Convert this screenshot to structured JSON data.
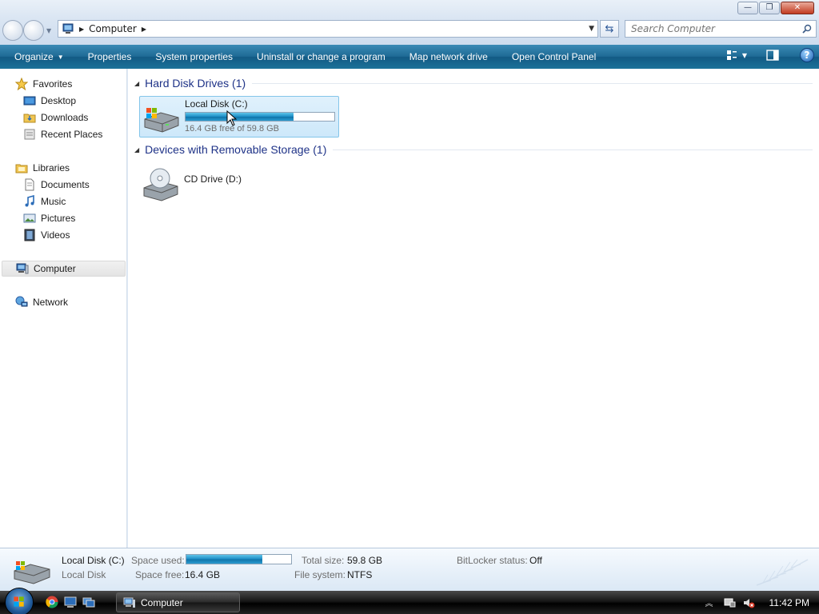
{
  "window": {
    "caption_buttons": {
      "minimize": "—",
      "maximize": "❐",
      "close": "✕"
    }
  },
  "address": {
    "crumb": "Computer",
    "search_placeholder": "Search Computer"
  },
  "toolbar": {
    "organize": "Organize",
    "properties": "Properties",
    "system_properties": "System properties",
    "uninstall": "Uninstall or change a program",
    "map_drive": "Map network drive",
    "control_panel": "Open Control Panel",
    "help": "?"
  },
  "sidebar": {
    "favorites": "Favorites",
    "desktop": "Desktop",
    "downloads": "Downloads",
    "recent": "Recent Places",
    "libraries": "Libraries",
    "documents": "Documents",
    "music": "Music",
    "pictures": "Pictures",
    "videos": "Videos",
    "computer": "Computer",
    "network": "Network"
  },
  "groups": {
    "hdd": {
      "title": "Hard Disk Drives (1)",
      "drive": {
        "name": "Local Disk (C:)",
        "free_text": "16.4 GB free of 59.8 GB",
        "used_fraction": 0.726
      }
    },
    "removable": {
      "title": "Devices with Removable Storage (1)",
      "drive": {
        "name": "CD Drive (D:)"
      }
    }
  },
  "details": {
    "name": "Local Disk (C:)",
    "type": "Local Disk",
    "space_used_label": "Space used:",
    "used_fraction": 0.726,
    "space_free_label": "Space free:",
    "space_free": "16.4 GB",
    "total_size_label": "Total size:",
    "total_size": "59.8 GB",
    "file_system_label": "File system:",
    "file_system": "NTFS",
    "bitlocker_label": "BitLocker status:",
    "bitlocker": "Off"
  },
  "taskbar": {
    "task_label": "Computer",
    "clock": "11:42 PM"
  }
}
